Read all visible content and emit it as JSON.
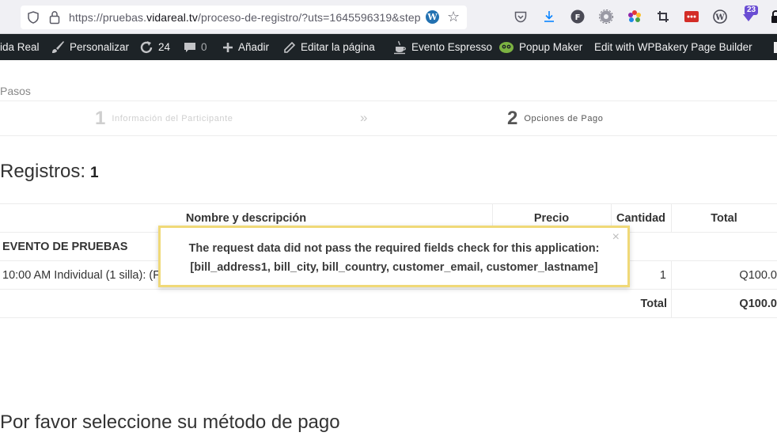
{
  "browser": {
    "url_prefix": "https://pruebas.",
    "url_domain": "vidareal.tv",
    "url_suffix": "/proceso-de-registro/?uts=1645596319&step",
    "ext_badge_count": "23"
  },
  "admin_bar": {
    "site_name": "ida Real",
    "customize": "Personalizar",
    "updates_count": "24",
    "comments_count": "0",
    "add_new": "Añadir",
    "edit_page": "Editar la página",
    "event_espresso": "Evento Espresso",
    "popup_maker": "Popup Maker",
    "wpbakery": "Edit with WPBakery Page Builder"
  },
  "steps": {
    "label": "Pasos",
    "step1_num": "1",
    "step1_text": "Información del Participante",
    "separator": "»",
    "step2_num": "2",
    "step2_text": "Opciones de Pago"
  },
  "registrations": {
    "title": "Registros:",
    "count": "1"
  },
  "table": {
    "headers": {
      "name": "Nombre y descripción",
      "price": "Precio",
      "quantity": "Cantidad",
      "total": "Total"
    },
    "event_name": "EVENTO DE PRUEBAS",
    "item_desc": "10:00 AM Individual (1 silla): (F",
    "item_qty": "1",
    "item_total": "Q100.0",
    "total_label": "Total",
    "grand_total": "Q100.0"
  },
  "alert": {
    "line1": "The request data did not pass the required fields check for this application:",
    "line2": "[bill_address1, bill_city, bill_country, customer_email, customer_lastname]",
    "close": "×"
  },
  "payment": {
    "title": "Por favor seleccione su método de pago"
  }
}
